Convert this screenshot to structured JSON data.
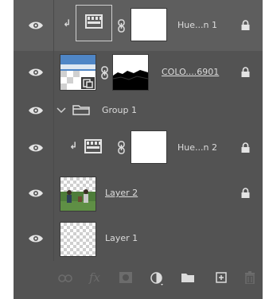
{
  "layers": [
    {
      "id": "hue1",
      "name": "Hue...n 1",
      "type": "adjustment",
      "clipped": true,
      "locked": true,
      "selected": true
    },
    {
      "id": "colo",
      "name": "COLO....6901",
      "type": "smart-object-masked",
      "clipped": false,
      "locked": true
    },
    {
      "id": "group1",
      "name": "Group 1",
      "type": "group"
    },
    {
      "id": "hue2",
      "name": "Hue...n 2",
      "type": "adjustment",
      "clipped": true,
      "locked": true
    },
    {
      "id": "layer2",
      "name": "Layer 2",
      "type": "pixel",
      "locked": true
    },
    {
      "id": "layer1",
      "name": "Layer 1",
      "type": "pixel",
      "locked": false
    }
  ],
  "toolbar": {
    "icons": [
      "link-layers-icon",
      "fx-icon",
      "add-mask-icon",
      "adjustment-layer-icon",
      "new-group-icon",
      "new-layer-icon",
      "trash-icon"
    ],
    "fx_label": "fx"
  },
  "colors": {
    "panel_bg": "#535353",
    "row_divider": "#434343",
    "text": "#dcdcdc",
    "icon": "#6c6c6c"
  }
}
